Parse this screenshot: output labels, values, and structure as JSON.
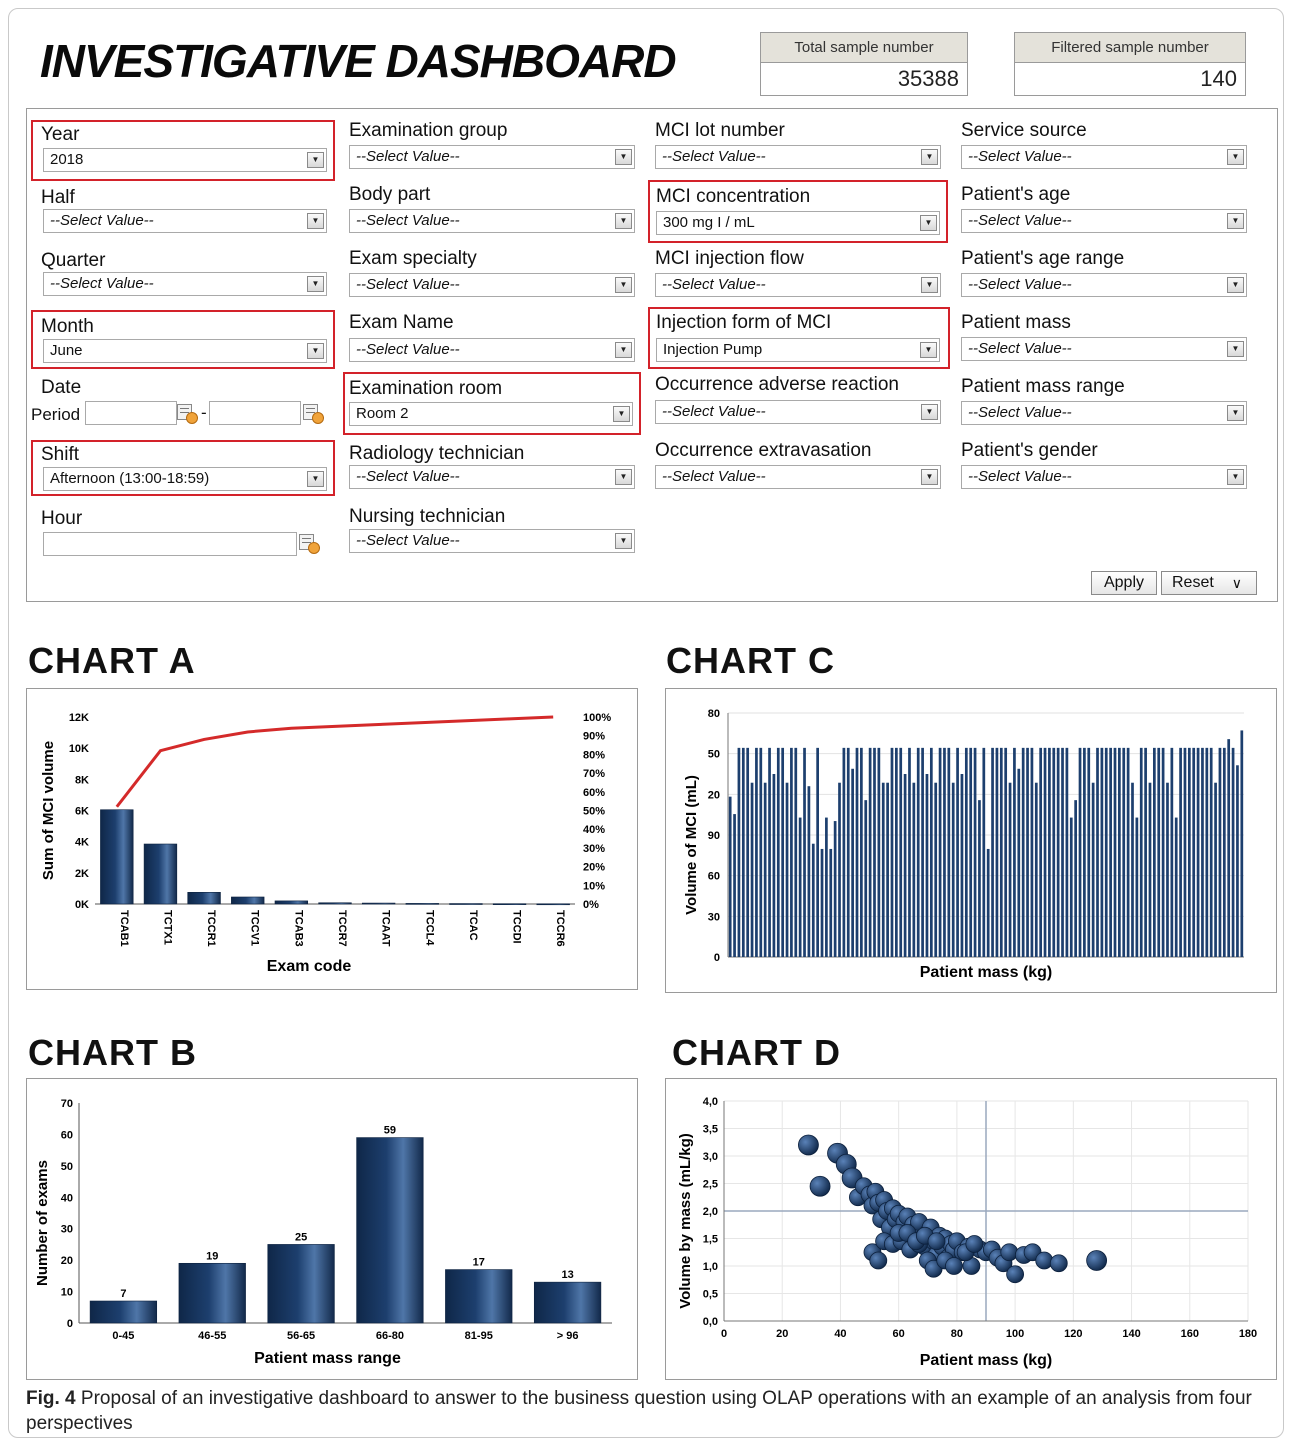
{
  "dashboard": {
    "title": "INVESTIGATIVE DASHBOARD",
    "total_label": "Total sample number",
    "total_value": "35388",
    "filtered_label": "Filtered sample number",
    "filtered_value": "140"
  },
  "filters": {
    "year": {
      "label": "Year",
      "value": "2018"
    },
    "half": {
      "label": "Half",
      "value": "--Select Value--"
    },
    "quarter": {
      "label": "Quarter",
      "value": "--Select Value--"
    },
    "month": {
      "label": "Month",
      "value": "June"
    },
    "date": {
      "label": "Date",
      "period_label": "Period",
      "separator": "-"
    },
    "shift": {
      "label": "Shift",
      "value": "Afternoon (13:00-18:59)"
    },
    "hour": {
      "label": "Hour"
    },
    "examination_group": {
      "label": "Examination group",
      "value": "--Select Value--"
    },
    "body_part": {
      "label": "Body part",
      "value": "--Select Value--"
    },
    "exam_specialty": {
      "label": "Exam specialty",
      "value": "--Select Value--"
    },
    "exam_name": {
      "label": "Exam Name",
      "value": "--Select Value--"
    },
    "examination_room": {
      "label": "Examination room",
      "value": "Room 2"
    },
    "radiology_technician": {
      "label": "Radiology technician",
      "value": "--Select Value--"
    },
    "nursing_technician": {
      "label": "Nursing technician",
      "value": "--Select Value--"
    },
    "mci_lot_number": {
      "label": "MCI lot number",
      "value": "--Select Value--"
    },
    "mci_concentration": {
      "label": "MCI concentration",
      "value": "300 mg I / mL"
    },
    "mci_injection_flow": {
      "label": "MCI injection flow",
      "value": "--Select Value--"
    },
    "injection_form": {
      "label": "Injection form of MCI",
      "value": "Injection Pump"
    },
    "adverse_reaction": {
      "label": "Occurrence adverse reaction",
      "value": "--Select Value--"
    },
    "extravasation": {
      "label": "Occurrence extravasation",
      "value": "--Select Value--"
    },
    "service_source": {
      "label": "Service source",
      "value": "--Select Value--"
    },
    "patient_age": {
      "label": "Patient's age",
      "value": "--Select Value--"
    },
    "patient_age_range": {
      "label": "Patient's age range",
      "value": "--Select Value--"
    },
    "patient_mass": {
      "label": "Patient mass",
      "value": "--Select Value--"
    },
    "patient_mass_range": {
      "label": "Patient mass range",
      "value": "--Select Value--"
    },
    "patient_gender": {
      "label": "Patient's gender",
      "value": "--Select Value--"
    }
  },
  "actions": {
    "apply": "Apply",
    "reset": "Reset",
    "reset_arrow": "∨"
  },
  "highlight_color": "#d3222a",
  "bar_color": "#1d3f6e",
  "line_color": "#d42a2a",
  "charts": {
    "a": {
      "heading": "CHART A"
    },
    "b": {
      "heading": "CHART B"
    },
    "c": {
      "heading": "CHART C"
    },
    "d": {
      "heading": "CHART D"
    }
  },
  "caption": {
    "label": "Fig. 4",
    "text": "Proposal of an investigative dashboard to answer to the business question using OLAP operations with an example of an analysis from four perspectives"
  },
  "chart_data": [
    {
      "id": "a",
      "type": "bar",
      "categories": [
        "TCAB1",
        "TCTX1",
        "TCCR1",
        "TCCV1",
        "TCAB3",
        "TCCR7",
        "TCAAT",
        "TCCL4",
        "TCAC",
        "TCCDI",
        "TCCR6"
      ],
      "values": [
        6050,
        3850,
        750,
        450,
        200,
        80,
        60,
        40,
        30,
        20,
        15
      ],
      "cumulative_percent": [
        52,
        82,
        88,
        92,
        94,
        95,
        96,
        97,
        98,
        99,
        100
      ],
      "xlabel": "Exam code",
      "ylabel": "Sum of MCI volume",
      "ylim": [
        0,
        12000
      ],
      "yticks": [
        "0K",
        "2K",
        "4K",
        "6K",
        "8K",
        "10K",
        "12K"
      ],
      "y2ticks": [
        "0%",
        "10%",
        "20%",
        "30%",
        "40%",
        "50%",
        "60%",
        "70%",
        "80%",
        "90%",
        "100%"
      ]
    },
    {
      "id": "b",
      "type": "bar",
      "categories": [
        "0-45",
        "46-55",
        "56-65",
        "66-80",
        "81-95",
        "> 96"
      ],
      "values": [
        7,
        19,
        25,
        59,
        17,
        13
      ],
      "xlabel": "Patient mass range",
      "ylabel": "Number of exams",
      "ylim": [
        0,
        70
      ],
      "yticks": [
        "0",
        "10",
        "20",
        "30",
        "40",
        "50",
        "60",
        "70"
      ]
    },
    {
      "id": "c",
      "type": "bar",
      "values": [
        92,
        82,
        120,
        120,
        120,
        100,
        120,
        120,
        100,
        120,
        105,
        120,
        120,
        100,
        120,
        120,
        80,
        120,
        98,
        65,
        120,
        62,
        80,
        62,
        78,
        100,
        120,
        120,
        108,
        120,
        120,
        90,
        120,
        120,
        120,
        100,
        100,
        120,
        120,
        120,
        105,
        120,
        100,
        120,
        120,
        105,
        120,
        100,
        120,
        120,
        120,
        100,
        120,
        105,
        120,
        120,
        120,
        90,
        120,
        62,
        120,
        120,
        120,
        120,
        100,
        120,
        108,
        120,
        120,
        120,
        100,
        120,
        120,
        120,
        120,
        120,
        120,
        120,
        80,
        90,
        120,
        120,
        120,
        100,
        120,
        120,
        120,
        120,
        120,
        120,
        120,
        120,
        100,
        80,
        120,
        120,
        100,
        120,
        120,
        120,
        100,
        120,
        80,
        120,
        120,
        120,
        120,
        120,
        120,
        120,
        120,
        100,
        120,
        120,
        125,
        120,
        110,
        130
      ],
      "xlabel": "Patient mass (kg)",
      "ylabel": "Volume of MCI (mL)",
      "ylim": [
        0,
        140
      ],
      "yticks": [
        "0",
        "30",
        "60",
        "90",
        "20",
        "50",
        "80"
      ]
    },
    {
      "id": "d",
      "type": "scatter",
      "xlabel": "Patient mass (kg)",
      "ylabel": "Volume by mass (mL/kg)",
      "xlim": [
        0,
        180
      ],
      "ylim": [
        0,
        4
      ],
      "xticks": [
        "0",
        "20",
        "40",
        "60",
        "80",
        "100",
        "120",
        "140",
        "160",
        "180"
      ],
      "yticks": [
        "0,0",
        "0,5",
        "1,0",
        "1,5",
        "2,0",
        "2,5",
        "3,0",
        "3,5",
        "4,0"
      ],
      "reference_lines": {
        "x": 90,
        "y": 2.0
      },
      "points": [
        [
          29,
          3.2
        ],
        [
          33,
          2.45
        ],
        [
          39,
          3.05
        ],
        [
          42,
          2.85
        ],
        [
          44,
          2.6
        ],
        [
          46,
          2.25
        ],
        [
          48,
          2.45
        ],
        [
          50,
          2.3
        ],
        [
          51,
          2.1
        ],
        [
          52,
          2.35
        ],
        [
          53,
          2.15
        ],
        [
          54,
          1.85
        ],
        [
          55,
          2.2
        ],
        [
          56,
          2.0
        ],
        [
          57,
          1.7
        ],
        [
          58,
          2.05
        ],
        [
          59,
          1.85
        ],
        [
          60,
          1.95
        ],
        [
          61,
          1.6
        ],
        [
          62,
          1.8
        ],
        [
          63,
          1.9
        ],
        [
          64,
          1.55
        ],
        [
          65,
          1.75
        ],
        [
          66,
          1.65
        ],
        [
          67,
          1.8
        ],
        [
          68,
          1.5
        ],
        [
          69,
          1.35
        ],
        [
          70,
          1.6
        ],
        [
          71,
          1.7
        ],
        [
          72,
          1.45
        ],
        [
          73,
          1.2
        ],
        [
          74,
          1.55
        ],
        [
          75,
          1.35
        ],
        [
          76,
          1.5
        ],
        [
          77,
          1.15
        ],
        [
          78,
          1.4
        ],
        [
          79,
          1.3
        ],
        [
          80,
          1.45
        ],
        [
          82,
          1.25
        ],
        [
          84,
          1.35
        ],
        [
          85,
          1.0
        ],
        [
          88,
          1.3
        ],
        [
          90,
          1.25
        ],
        [
          92,
          1.3
        ],
        [
          94,
          1.15
        ],
        [
          96,
          1.05
        ],
        [
          98,
          1.25
        ],
        [
          100,
          0.85
        ],
        [
          103,
          1.2
        ],
        [
          106,
          1.25
        ],
        [
          110,
          1.1
        ],
        [
          115,
          1.05
        ],
        [
          128,
          1.1
        ],
        [
          51,
          1.25
        ],
        [
          53,
          1.1
        ],
        [
          55,
          1.45
        ],
        [
          58,
          1.4
        ],
        [
          61,
          1.45
        ],
        [
          64,
          1.3
        ],
        [
          67,
          1.4
        ],
        [
          70,
          1.1
        ],
        [
          72,
          0.95
        ],
        [
          76,
          1.1
        ],
        [
          79,
          1.0
        ],
        [
          83,
          1.25
        ],
        [
          86,
          1.4
        ],
        [
          60,
          1.6
        ],
        [
          63,
          1.6
        ],
        [
          66,
          1.45
        ],
        [
          69,
          1.55
        ],
        [
          73,
          1.45
        ]
      ]
    }
  ]
}
